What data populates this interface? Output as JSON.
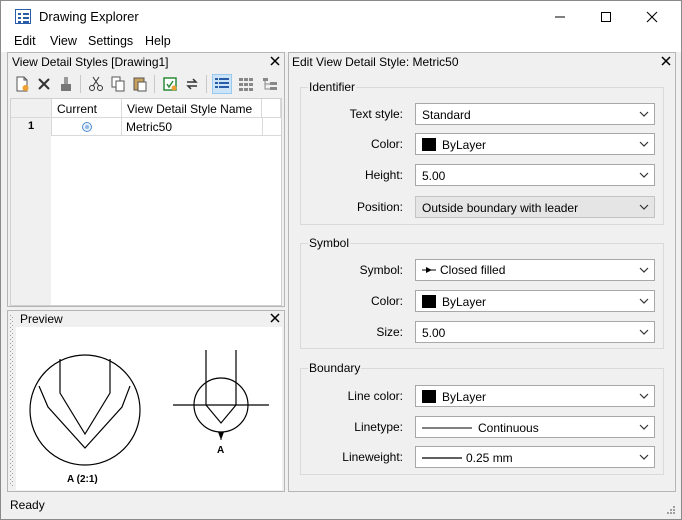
{
  "window": {
    "title": "Drawing Explorer",
    "minimize": "—",
    "maximize": "☐",
    "close": "✕"
  },
  "menu": [
    "Edit",
    "View",
    "Settings",
    "Help"
  ],
  "styles_panel": {
    "title": "View Detail Styles [Drawing1]",
    "close": "✕",
    "columns": [
      "Current",
      "View Detail Style Name"
    ],
    "rows": [
      {
        "index": "1",
        "name": "Metric50"
      }
    ]
  },
  "preview_panel": {
    "title": "Preview",
    "close": "✕",
    "label_left": "A (2:1)",
    "label_right": "A"
  },
  "edit_panel": {
    "title": "Edit View Detail Style: Metric50",
    "close": "✕",
    "groups": {
      "identifier": {
        "title": "Identifier",
        "text_style": {
          "label": "Text style:",
          "value": "Standard"
        },
        "color": {
          "label": "Color:",
          "value": "ByLayer"
        },
        "height": {
          "label": "Height:",
          "value": "5.00"
        },
        "position": {
          "label": "Position:",
          "value": "Outside boundary with leader"
        }
      },
      "symbol": {
        "title": "Symbol",
        "symbol": {
          "label": "Symbol:",
          "value": "Closed filled"
        },
        "color": {
          "label": "Color:",
          "value": "ByLayer"
        },
        "size": {
          "label": "Size:",
          "value": "5.00"
        }
      },
      "boundary": {
        "title": "Boundary",
        "line_color": {
          "label": "Line color:",
          "value": "ByLayer"
        },
        "linetype": {
          "label": "Linetype:",
          "value": "Continuous"
        },
        "lineweight": {
          "label": "Lineweight:",
          "value": "0.25 mm"
        }
      }
    }
  },
  "status": {
    "text": "Ready"
  },
  "colors": {
    "accent": "#2a5da8",
    "panel": "#f0f0f0",
    "selection": "#cce4f7"
  }
}
